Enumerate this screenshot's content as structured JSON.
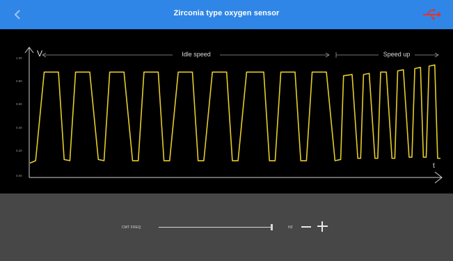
{
  "header": {
    "title": "Zirconia type oxygen sensor",
    "back_icon": "chevron-left-icon",
    "connection_icon": "usb-connection-icon",
    "bar_color": "#2f86e6",
    "connection_color": "#e8312e"
  },
  "scope": {
    "y_axis_label": "V",
    "x_axis_label": "t",
    "y_ticks": [
      "1.00",
      "0.80",
      "0.60",
      "0.40",
      "0.20",
      "0.00"
    ],
    "regions": [
      {
        "label": "Idle speed"
      },
      {
        "label": "Speed up"
      }
    ],
    "trace_color": "#e6cc2c"
  },
  "controls": {
    "freq_label": "CMT FREQ",
    "unit_label": "HZ",
    "slider_level": 1.0,
    "minus_icon": "minus-icon",
    "plus_icon": "plus-icon"
  },
  "chart_data": {
    "type": "line",
    "xlabel": "t",
    "ylabel": "V",
    "ylim": [
      0,
      1.0
    ],
    "series": [
      {
        "name": "",
        "description_points": [
          {
            "x": 0,
            "y": 0.12
          },
          {
            "x": 2,
            "y": 0.14
          },
          {
            "x": 5,
            "y": 0.88
          },
          {
            "x": 10,
            "y": 0.88
          },
          {
            "x": 12,
            "y": 0.15
          },
          {
            "x": 14,
            "y": 0.14
          },
          {
            "x": 16,
            "y": 0.88
          },
          {
            "x": 21,
            "y": 0.88
          },
          {
            "x": 24,
            "y": 0.15
          },
          {
            "x": 26,
            "y": 0.14
          },
          {
            "x": 28,
            "y": 0.88
          },
          {
            "x": 33,
            "y": 0.88
          },
          {
            "x": 36,
            "y": 0.14
          },
          {
            "x": 38,
            "y": 0.14
          },
          {
            "x": 40,
            "y": 0.88
          },
          {
            "x": 45,
            "y": 0.88
          },
          {
            "x": 47,
            "y": 0.14
          },
          {
            "x": 49,
            "y": 0.14
          },
          {
            "x": 52,
            "y": 0.88
          },
          {
            "x": 57,
            "y": 0.88
          },
          {
            "x": 59,
            "y": 0.14
          },
          {
            "x": 61,
            "y": 0.14
          },
          {
            "x": 64,
            "y": 0.88
          },
          {
            "x": 69,
            "y": 0.88
          },
          {
            "x": 71,
            "y": 0.14
          },
          {
            "x": 73,
            "y": 0.14
          },
          {
            "x": 76,
            "y": 0.88
          },
          {
            "x": 82,
            "y": 0.88
          },
          {
            "x": 84,
            "y": 0.14
          },
          {
            "x": 86,
            "y": 0.14
          },
          {
            "x": 88,
            "y": 0.88
          },
          {
            "x": 93,
            "y": 0.88
          },
          {
            "x": 95,
            "y": 0.14
          },
          {
            "x": 97,
            "y": 0.14
          },
          {
            "x": 99,
            "y": 0.88
          },
          {
            "x": 104,
            "y": 0.88
          },
          {
            "x": 107,
            "y": 0.14
          },
          {
            "x": 109,
            "y": 0.15
          },
          {
            "x": 110,
            "y": 0.85
          },
          {
            "x": 113,
            "y": 0.86
          },
          {
            "x": 115,
            "y": 0.16
          },
          {
            "x": 116,
            "y": 0.16
          },
          {
            "x": 117,
            "y": 0.86
          },
          {
            "x": 119,
            "y": 0.87
          },
          {
            "x": 121,
            "y": 0.16
          },
          {
            "x": 122,
            "y": 0.16
          },
          {
            "x": 123,
            "y": 0.88
          },
          {
            "x": 125,
            "y": 0.88
          },
          {
            "x": 127,
            "y": 0.16
          },
          {
            "x": 128,
            "y": 0.16
          },
          {
            "x": 129,
            "y": 0.89
          },
          {
            "x": 131,
            "y": 0.9
          },
          {
            "x": 133,
            "y": 0.17
          },
          {
            "x": 134,
            "y": 0.17
          },
          {
            "x": 135,
            "y": 0.91
          },
          {
            "x": 137,
            "y": 0.92
          },
          {
            "x": 138,
            "y": 0.17
          },
          {
            "x": 139,
            "y": 0.17
          },
          {
            "x": 140,
            "y": 0.93
          },
          {
            "x": 142,
            "y": 0.94
          },
          {
            "x": 143,
            "y": 0.16
          },
          {
            "x": 144,
            "y": 0.16
          }
        ]
      }
    ]
  }
}
